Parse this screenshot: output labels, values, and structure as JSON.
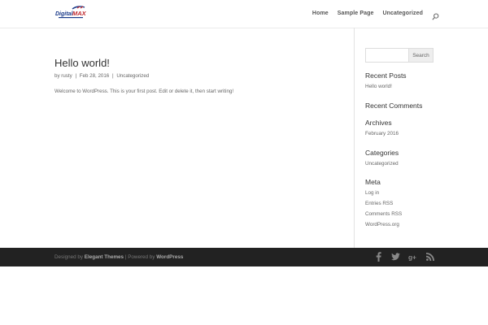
{
  "header": {
    "logo_alt": "DigitalMax",
    "nav": [
      "Home",
      "Sample Page",
      "Uncategorized"
    ]
  },
  "post": {
    "title": "Hello world!",
    "meta_by": "by",
    "author": "rusty",
    "date": "Feb 28, 2016",
    "category": "Uncategorized",
    "body": "Welcome to WordPress. This is your first post. Edit or delete it, then start writing!"
  },
  "sidebar": {
    "search_button": "Search",
    "recent_posts_title": "Recent Posts",
    "recent_posts": [
      "Hello world!"
    ],
    "recent_comments_title": "Recent Comments",
    "archives_title": "Archives",
    "archives": [
      "February 2016"
    ],
    "categories_title": "Categories",
    "categories": [
      "Uncategorized"
    ],
    "meta_title": "Meta",
    "meta": [
      "Log in",
      "Entries RSS",
      "Comments RSS",
      "WordPress.org"
    ]
  },
  "footer": {
    "designed_by": "Designed by",
    "elegant": "Elegant Themes",
    "powered_by": "| Powered by",
    "wordpress": "WordPress"
  },
  "colors": {
    "footer_bg": "#222222",
    "divider": "#e2e2e2"
  }
}
